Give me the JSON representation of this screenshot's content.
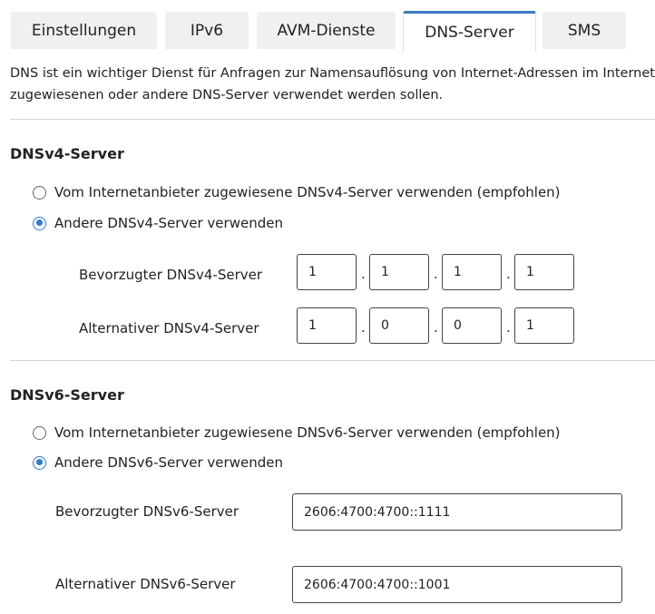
{
  "tabs": [
    {
      "label": "Einstellungen",
      "active": false
    },
    {
      "label": "IPv6",
      "active": false
    },
    {
      "label": "AVM-Dienste",
      "active": false
    },
    {
      "label": "DNS-Server",
      "active": true
    },
    {
      "label": "SMS",
      "active": false
    }
  ],
  "intro": {
    "line1": "DNS ist ein wichtiger Dienst für Anfragen zur Namensauflösung von Internet-Adressen im Internet. H",
    "line2": "zugewiesenen oder andere DNS-Server verwendet werden sollen."
  },
  "dnsv4": {
    "title": "DNSv4-Server",
    "option_provider": "Vom Internetanbieter zugewiesene DNSv4-Server verwenden (empfohlen)",
    "option_custom": "Andere DNSv4-Server verwenden",
    "selected": "custom",
    "preferred_label": "Bevorzugter DNSv4-Server",
    "preferred_octets": [
      "1",
      "1",
      "1",
      "1"
    ],
    "alternate_label": "Alternativer DNSv4-Server",
    "alternate_octets": [
      "1",
      "0",
      "0",
      "1"
    ],
    "separator": "."
  },
  "dnsv6": {
    "title": "DNSv6-Server",
    "option_provider": "Vom Internetanbieter zugewiesene DNSv6-Server verwenden (empfohlen)",
    "option_custom": "Andere DNSv6-Server verwenden",
    "selected": "custom",
    "preferred_label": "Bevorzugter DNSv6-Server",
    "preferred_value": "2606:4700:4700::1111",
    "alternate_label": "Alternativer DNSv6-Server",
    "alternate_value": "2606:4700:4700::1001"
  },
  "colors": {
    "accent": "#3b7ac2",
    "radio_checked": "#2f7ccf",
    "tab_bg": "#f0f0f0",
    "divider": "#d4d4d4"
  }
}
